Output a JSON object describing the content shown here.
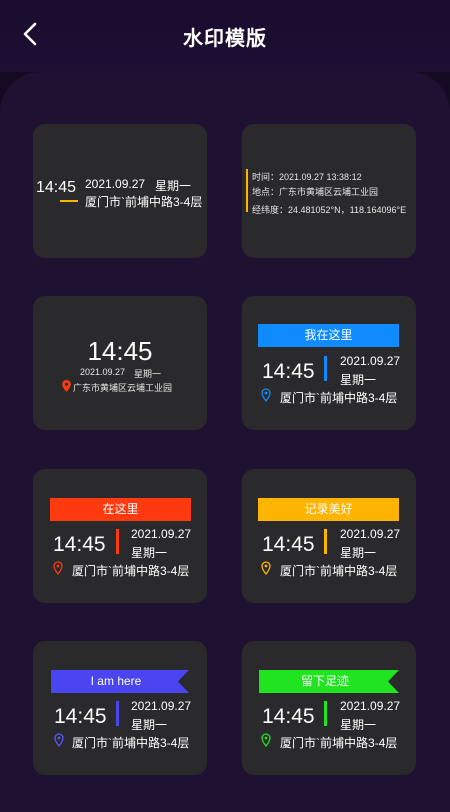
{
  "header": {
    "title": "水印模版",
    "back_icon": "chevron-left-icon"
  },
  "colors": {
    "yellow": "#ffb400",
    "blue": "#0f8bff",
    "red": "#ff3a0f",
    "green": "#1fe41f",
    "purple": "#4a45f0"
  },
  "templates": [
    {
      "time": "14:45",
      "date": "2021.09.27",
      "weekday": "星期一",
      "address": "厦门市`前埔中路3-4层"
    },
    {
      "line1": "时间：2021.09.27   13:38:12",
      "line2": "地点：广东市黄埔区云埔工业园",
      "line3": "经纬度：24.481052°N，118.164096°E"
    },
    {
      "time": "14:45",
      "date": "2021.09.27",
      "weekday": "星期一",
      "address": "广东市黄埔区云埔工业园"
    },
    {
      "banner": "我在这里",
      "time": "14:45",
      "date": "2021.09.27",
      "weekday": "星期一",
      "address": "厦门市`前埔中路3-4层"
    },
    {
      "banner": "在这里",
      "time": "14:45",
      "date": "2021.09.27",
      "weekday": "星期一",
      "address": "厦门市`前埔中路3-4层"
    },
    {
      "banner": "记录美好",
      "time": "14:45",
      "date": "2021.09.27",
      "weekday": "星期一",
      "address": "厦门市`前埔中路3-4层"
    },
    {
      "banner": "I am here",
      "time": "14:45",
      "date": "2021.09.27",
      "weekday": "星期一",
      "address": "厦门市`前埔中路3-4层"
    },
    {
      "banner": "留下足迹",
      "time": "14:45",
      "date": "2021.09.27",
      "weekday": "星期一",
      "address": "厦门市`前埔中路3-4层"
    }
  ]
}
